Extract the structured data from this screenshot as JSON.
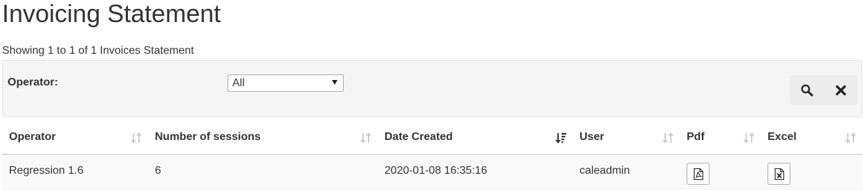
{
  "page": {
    "title": "Invoicing Statement",
    "showing": "Showing 1 to 1 of 1 Invoices Statement"
  },
  "filter": {
    "operator_label": "Operator:",
    "operator_value": "All",
    "search_icon": "search-icon",
    "clear_icon": "close-icon"
  },
  "table": {
    "columns": [
      {
        "label": "Operator",
        "sort": "unsorted"
      },
      {
        "label": "Number of sessions",
        "sort": "unsorted"
      },
      {
        "label": "Date Created",
        "sort": "descending"
      },
      {
        "label": "User",
        "sort": "unsorted"
      },
      {
        "label": "Pdf",
        "sort": "unsorted"
      },
      {
        "label": "Excel",
        "sort": "unsorted"
      }
    ],
    "rows": [
      {
        "operator": "Regression 1.6",
        "sessions": "6",
        "date_created": "2020-01-08 16:35:16",
        "user": "caleadmin",
        "pdf_icon": "pdf-file-icon",
        "excel_icon": "excel-file-icon"
      }
    ]
  },
  "colors": {
    "panel_bg": "#f5f5f5",
    "row_bg": "#f9f9f9",
    "sort_inactive": "#cccccc",
    "sort_active": "#333333"
  }
}
